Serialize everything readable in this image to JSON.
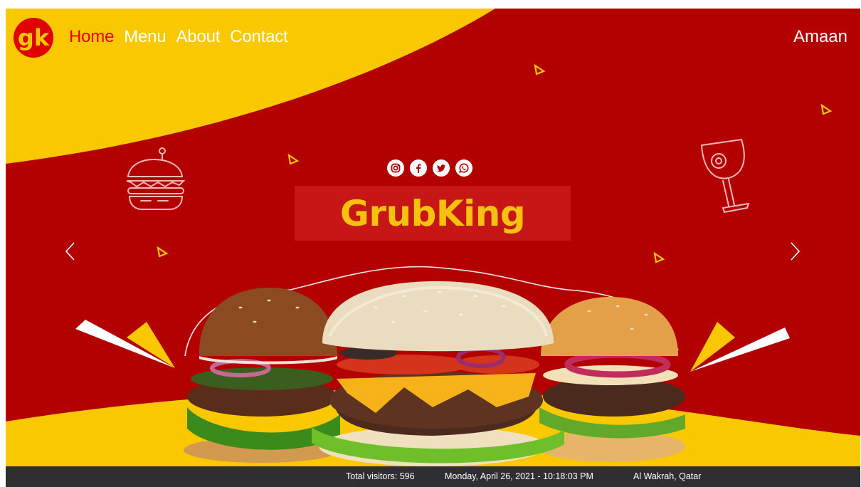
{
  "brand": {
    "logo_text": "gk",
    "title": "GrubKing"
  },
  "nav": {
    "items": [
      {
        "label": "Home",
        "active": true
      },
      {
        "label": "Menu",
        "active": false
      },
      {
        "label": "About",
        "active": false
      },
      {
        "label": "Contact",
        "active": false
      }
    ],
    "user": "Amaan"
  },
  "social": [
    "instagram-icon",
    "facebook-icon",
    "twitter-icon",
    "whatsapp-icon"
  ],
  "carousel": {
    "prev_icon": "chevron-left-icon",
    "next_icon": "chevron-right-icon",
    "slide_image": "burgers-image"
  },
  "footer": {
    "visitors": "Total visitors: 596",
    "datetime": "Monday, April 26, 2021 - 10:18:03 PM",
    "location": "Al Wakrah, Qatar"
  },
  "colors": {
    "red": "#b30000",
    "yellow": "#f9c800",
    "active_link": "#e60000",
    "footer_bg": "#2f2f32"
  }
}
